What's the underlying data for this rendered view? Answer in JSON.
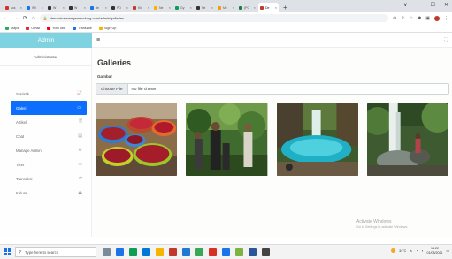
{
  "browser": {
    "tabs": [
      {
        "label": "sos",
        "color": "#d93025"
      },
      {
        "label": "Wil",
        "color": "#1a73e8"
      },
      {
        "label": "W",
        "color": "#333333"
      },
      {
        "label": "W",
        "color": "#333333"
      },
      {
        "label": "de",
        "color": "#1a73e8"
      },
      {
        "label": "PD",
        "color": "#333333"
      },
      {
        "label": "Kin",
        "color": "#c0392b"
      },
      {
        "label": "Ne",
        "color": "#f4b400"
      },
      {
        "label": "Gy",
        "color": "#0f9d58"
      },
      {
        "label": "Ne",
        "color": "#333333"
      },
      {
        "label": "Mc",
        "color": "#e8a500"
      },
      {
        "label": "(PC",
        "color": "#188038"
      },
      {
        "label": "De",
        "color": "#c0392b",
        "active": true
      }
    ],
    "new_tab": "+",
    "window_controls": [
      "∨",
      "—",
      "☐",
      "✕"
    ],
    "nav": {
      "back": "←",
      "forward": "→",
      "reload": "⟳",
      "home": "⌂"
    },
    "url": "desawisatamegamendung.com/admin/galleries",
    "bookmarks": [
      {
        "label": "Maps",
        "color": "#34a853"
      },
      {
        "label": "Gmail",
        "color": "#d93025"
      },
      {
        "label": "YouTube",
        "color": "#ff0000"
      },
      {
        "label": "Translate",
        "color": "#1a73e8"
      },
      {
        "label": "Sign Up",
        "color": "#f4b400"
      }
    ]
  },
  "app": {
    "brand": "Admin",
    "user": "Administrator",
    "menu_icon": "≡",
    "expand_icon": "⛶",
    "menu": [
      {
        "label": "Statistik",
        "icon": "📈",
        "icon_name": "chart-icon"
      },
      {
        "label": "Galeri",
        "icon": "▭",
        "icon_name": "image-icon",
        "active": true
      },
      {
        "label": "Artikel",
        "icon": "🗎",
        "icon_name": "document-icon"
      },
      {
        "label": "Chat",
        "icon": "▤",
        "icon_name": "chat-icon"
      },
      {
        "label": "Manage Admin",
        "icon": "⚙",
        "icon_name": "gear-icon"
      },
      {
        "label": "Tiket",
        "icon": "▭",
        "icon_name": "ticket-icon"
      },
      {
        "label": "Transaksi",
        "icon": "⇄",
        "icon_name": "transaction-icon"
      },
      {
        "label": "Keluar",
        "icon": "⏏",
        "icon_name": "logout-icon"
      }
    ]
  },
  "content": {
    "title": "Galleries",
    "field_label": "Gambar",
    "file_button": "Choose File",
    "file_status": "No file chosen"
  },
  "watermark": {
    "line1": "Activate Windows",
    "line2": "Go to Settings to activate Windows."
  },
  "taskbar": {
    "search_placeholder": "Type here to search",
    "apps": [
      "#7a8b99",
      "#1a73e8",
      "#0f9d58",
      "#0078d7",
      "#f4b400",
      "#c0392b",
      "#1f78d1",
      "#3aa757",
      "#d93025",
      "#1a73e8",
      "#7cb342",
      "#2b579a",
      "#444444"
    ],
    "weather": "34°C",
    "time": "14:22",
    "date": "01/08/2021"
  }
}
